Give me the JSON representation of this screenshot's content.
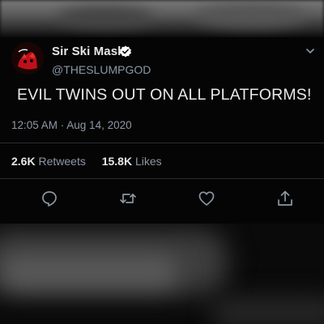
{
  "tweet": {
    "author": {
      "name": "Sir Ski Mask",
      "handle": "@THESLUMPGOD",
      "verified": true
    },
    "text": "EVIL TWINS OUT ON ALL PLATFORMS!",
    "timestamp": "12:05 AM · Aug 14, 2020",
    "stats": {
      "retweets_count": "2.6K",
      "retweets_label": "Retweets",
      "likes_count": "15.8K",
      "likes_label": "Likes"
    },
    "actions": [
      "reply-icon",
      "retweet-icon",
      "like-icon",
      "share-icon"
    ]
  },
  "colors": {
    "background": "#050505",
    "text": "#e9e9e9",
    "secondary_text": "#8b98a5",
    "verified_badge": "#ffffff",
    "avatar_accent": "#c0101a"
  }
}
